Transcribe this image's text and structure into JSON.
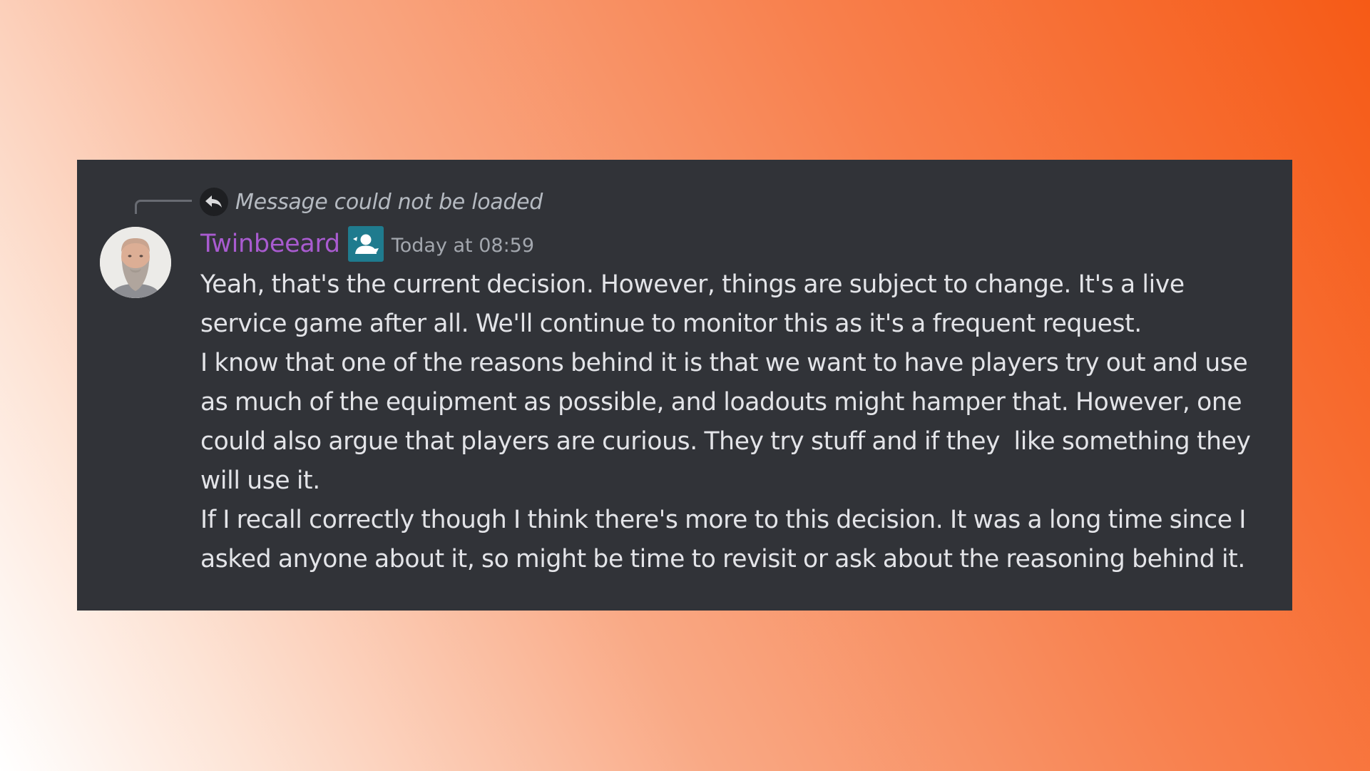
{
  "reply": {
    "text": "Message could not be loaded",
    "icon": "reply-arrow-icon"
  },
  "message": {
    "author": "Twinbeeard",
    "author_color": "#a95bd0",
    "role_icon": "role-badge-icon",
    "role_color": "#1f7b8e",
    "timestamp": "Today at 08:59",
    "paragraphs": [
      "Yeah, that's the current decision. However, things are subject to change. It's a live service game after all. We'll continue to monitor this as it's a frequent request.",
      "I know that one of the reasons behind it is that we want to have players try out and use as much of the equipment as possible, and loadouts might hamper that. However, one could also argue that players are curious. They try stuff and if they  like something they will use it.",
      "If I recall correctly though I think there's more to this decision. It was a long time since I asked anyone about it, so might be time to revisit or ask about the reasoning behind it."
    ]
  },
  "colors": {
    "card_background": "#313338",
    "message_text": "#e3e4e8",
    "muted_text": "#b5bac1"
  }
}
